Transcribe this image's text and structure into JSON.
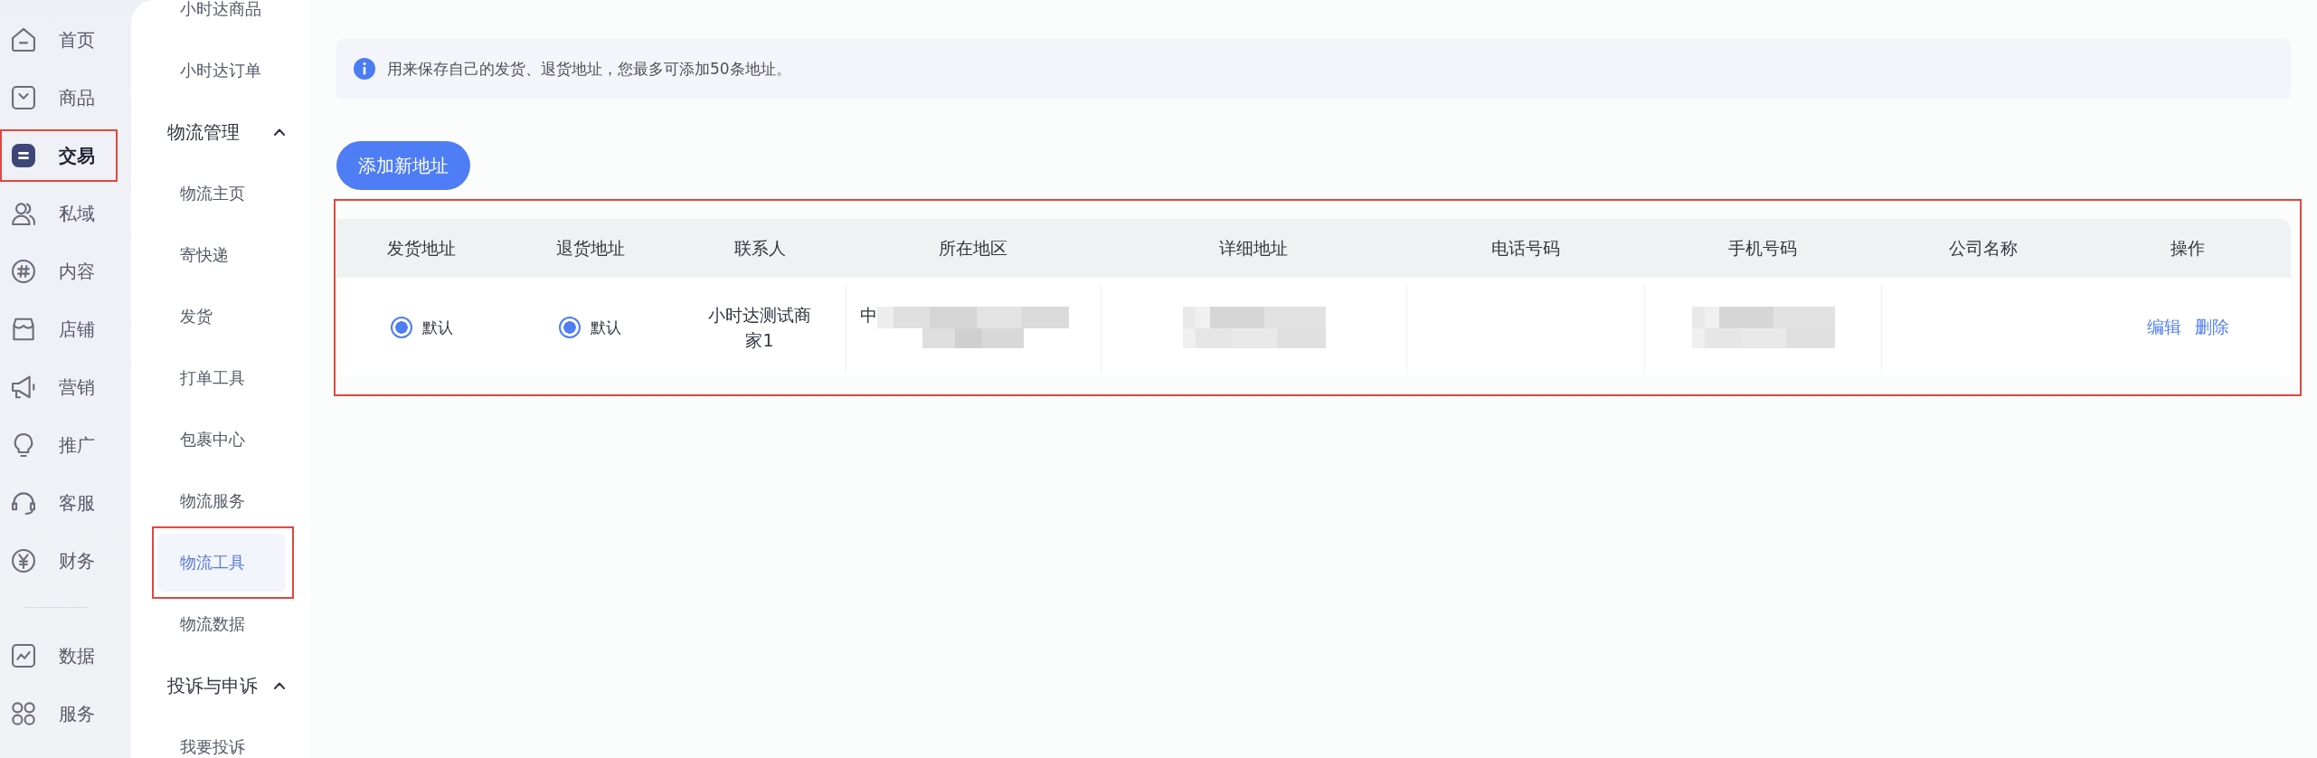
{
  "nav": {
    "sections": [
      {
        "items": [
          {
            "label": "首页",
            "selected": false,
            "highlighted": false
          },
          {
            "label": "商品",
            "selected": false,
            "highlighted": false
          },
          {
            "label": "交易",
            "selected": true,
            "highlighted": true
          },
          {
            "label": "私域",
            "selected": false,
            "highlighted": false
          },
          {
            "label": "内容",
            "selected": false,
            "highlighted": false
          },
          {
            "label": "店铺",
            "selected": false,
            "highlighted": false
          },
          {
            "label": "营销",
            "selected": false,
            "highlighted": false
          },
          {
            "label": "推广",
            "selected": false,
            "highlighted": false
          },
          {
            "label": "客服",
            "selected": false,
            "highlighted": false
          },
          {
            "label": "财务",
            "selected": false,
            "highlighted": false
          }
        ]
      },
      {
        "items": [
          {
            "label": "数据",
            "selected": false,
            "highlighted": false
          },
          {
            "label": "服务",
            "selected": false,
            "highlighted": false
          }
        ]
      }
    ]
  },
  "subnav": {
    "items": [
      {
        "kind": "link",
        "label": "小时达商品",
        "selected": false,
        "highlighted": false
      },
      {
        "kind": "link",
        "label": "小时达订单",
        "selected": false,
        "highlighted": false
      },
      {
        "kind": "group",
        "label": "物流管理",
        "expanded": true,
        "children": [
          {
            "label": "物流主页",
            "selected": false,
            "highlighted": false
          },
          {
            "label": "寄快递",
            "selected": false,
            "highlighted": false
          },
          {
            "label": "发货",
            "selected": false,
            "highlighted": false
          },
          {
            "label": "打单工具",
            "selected": false,
            "highlighted": false
          },
          {
            "label": "包裹中心",
            "selected": false,
            "highlighted": false
          },
          {
            "label": "物流服务",
            "selected": false,
            "highlighted": false
          },
          {
            "label": "物流工具",
            "selected": true,
            "highlighted": true
          },
          {
            "label": "物流数据",
            "selected": false,
            "highlighted": false
          }
        ]
      },
      {
        "kind": "group",
        "label": "投诉与申诉",
        "expanded": true,
        "children": [
          {
            "label": "我要投诉",
            "selected": false,
            "highlighted": false
          }
        ]
      }
    ]
  },
  "notice": {
    "text": "用来保存自己的发货、退货地址，您最多可添加50条地址。"
  },
  "add_button": {
    "label": "添加新地址"
  },
  "table": {
    "highlighted": true,
    "columns": [
      "发货地址",
      "退货地址",
      "联系人",
      "所在地区",
      "详细地址",
      "电话号码",
      "手机号码",
      "公司名称",
      "操作"
    ],
    "rows": [
      {
        "cells": [
          {
            "kind": "radio",
            "label": "默认",
            "selected": true
          },
          {
            "kind": "radio",
            "label": "默认",
            "selected": true
          },
          {
            "kind": "text",
            "text": "小时达测试商家1"
          },
          {
            "kind": "redacted",
            "text": "中"
          },
          {
            "kind": "redacted"
          },
          {
            "kind": "empty"
          },
          {
            "kind": "redacted"
          },
          {
            "kind": "empty"
          },
          {
            "kind": "actions",
            "actions": [
              "编辑",
              "删除"
            ]
          }
        ]
      }
    ]
  }
}
